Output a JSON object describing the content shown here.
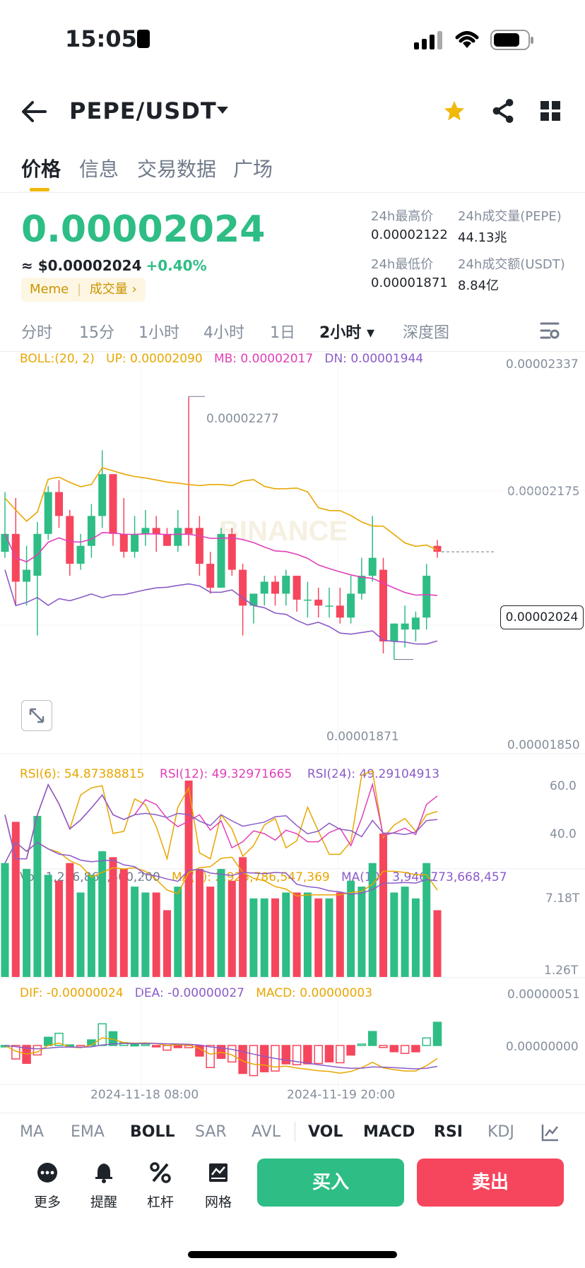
{
  "status_bar": {
    "time": "15:05"
  },
  "header": {
    "pair": "PEPE/USDT"
  },
  "tabs": [
    "价格",
    "信息",
    "交易数据",
    "广场"
  ],
  "price": {
    "last": "0.00002024",
    "usd": "≈ $0.00002024",
    "change": "+0.40%",
    "tag_meme": "Meme",
    "tag_volume": "成交量 ›"
  },
  "stats": {
    "high_label": "24h最高价",
    "high_value": "0.00002122",
    "vol_base_label": "24h成交量(PEPE)",
    "vol_base_value": "44.13兆",
    "low_label": "24h最低价",
    "low_value": "0.00001871",
    "vol_quote_label": "24h成交额(USDT)",
    "vol_quote_value": "8.84亿"
  },
  "intervals": [
    "分时",
    "15分",
    "1小时",
    "4小时",
    "1日",
    "2小时 ▾",
    "深度图"
  ],
  "boll": {
    "label": "BOLL:(20, 2)",
    "up": "UP: 0.00002090",
    "mb": "MB: 0.00002017",
    "dn": "DN: 0.00001944"
  },
  "price_axis": [
    "0.00002337",
    "0.00002175",
    "0.00001850"
  ],
  "price_marks": {
    "high": "0.00002277",
    "low": "0.00001871",
    "current": "0.00002024"
  },
  "watermark": "BINANCE",
  "rsi": {
    "r6": "RSI(6): 54.87388815",
    "r12": "RSI(12): 49.32971665",
    "r24": "RSI(24): 49.29104913",
    "axis_hi": "60.0",
    "axis_lo": "40.0"
  },
  "vol": {
    "vol": "Vol: 1,256,867,400,200",
    "ma5": "MA(5): 2,925,786,547,369",
    "ma10": "MA(10): 3,946,773,668,457",
    "axis_hi": "7.18T",
    "axis_lo": "1.26T"
  },
  "macd": {
    "dif": "DIF: -0.00000024",
    "dea": "DEA: -0.00000027",
    "macd": "MACD: 0.00000003",
    "axis_hi": "0.00000051",
    "axis_mid": "0.00000000"
  },
  "time_axis": [
    "2024-11-18 08:00",
    "2024-11-19 20:00"
  ],
  "indicator_tabs": [
    "MA",
    "EMA",
    "BOLL",
    "SAR",
    "AVL",
    "VOL",
    "MACD",
    "RSI",
    "KDJ"
  ],
  "bottom_nav": [
    "更多",
    "提醒",
    "杠杆",
    "网格"
  ],
  "buy_label": "买入",
  "sell_label": "卖出",
  "colors": {
    "green": "#2ebd85",
    "red": "#f6465d",
    "yellow": "#f0b90b",
    "boll_up": "#e8a600",
    "boll_mb": "#e040b8",
    "boll_dn": "#8a5cc7"
  },
  "chart_data": {
    "type": "candlestick",
    "candles": [
      {
        "o": 2.02e-05,
        "c": 2.05e-05,
        "h": 2.12e-05,
        "l": 2.01e-05
      },
      {
        "o": 2.05e-05,
        "c": 1.97e-05,
        "h": 2.11e-05,
        "l": 1.93e-05
      },
      {
        "o": 1.97e-05,
        "c": 1.99e-05,
        "h": 2.03e-05,
        "l": 1.93e-05
      },
      {
        "o": 1.98e-05,
        "c": 2.05e-05,
        "h": 2.07e-05,
        "l": 1.88e-05
      },
      {
        "o": 2.05e-05,
        "c": 2.12e-05,
        "h": 2.13e-05,
        "l": 2.04e-05
      },
      {
        "o": 2.12e-05,
        "c": 2.08e-05,
        "h": 2.14e-05,
        "l": 2.06e-05
      },
      {
        "o": 2.08e-05,
        "c": 2e-05,
        "h": 2.09e-05,
        "l": 1.98e-05
      },
      {
        "o": 2e-05,
        "c": 2.03e-05,
        "h": 2.05e-05,
        "l": 1.99e-05
      },
      {
        "o": 2.03e-05,
        "c": 2.08e-05,
        "h": 2.1e-05,
        "l": 2.01e-05
      },
      {
        "o": 2.08e-05,
        "c": 2.15e-05,
        "h": 2.19e-05,
        "l": 2.06e-05
      },
      {
        "o": 2.15e-05,
        "c": 2.05e-05,
        "h": 2.15e-05,
        "l": 2.03e-05
      },
      {
        "o": 2.05e-05,
        "c": 2.02e-05,
        "h": 2.11e-05,
        "l": 2.01e-05
      },
      {
        "o": 2.02e-05,
        "c": 2.05e-05,
        "h": 2.08e-05,
        "l": 2.01e-05
      },
      {
        "o": 2.05e-05,
        "c": 2.06e-05,
        "h": 2.09e-05,
        "l": 2.03e-05
      },
      {
        "o": 2.06e-05,
        "c": 2.05e-05,
        "h": 2.08e-05,
        "l": 2.02e-05
      },
      {
        "o": 2.05e-05,
        "c": 2.03e-05,
        "h": 2.06e-05,
        "l": 2.03e-05
      },
      {
        "o": 2.03e-05,
        "c": 2.06e-05,
        "h": 2.09e-05,
        "l": 2.02e-05
      },
      {
        "o": 2.06e-05,
        "c": 2.05e-05,
        "h": 2.28e-05,
        "l": 2.03e-05
      },
      {
        "o": 2.06e-05,
        "c": 2e-05,
        "h": 2.08e-05,
        "l": 1.98e-05
      },
      {
        "o": 2e-05,
        "c": 1.96e-05,
        "h": 2.02e-05,
        "l": 1.95e-05
      },
      {
        "o": 1.96e-05,
        "c": 2.05e-05,
        "h": 2.06e-05,
        "l": 1.96e-05
      },
      {
        "o": 2.05e-05,
        "c": 1.99e-05,
        "h": 2.06e-05,
        "l": 1.98e-05
      },
      {
        "o": 1.99e-05,
        "c": 1.93e-05,
        "h": 2e-05,
        "l": 1.88e-05
      },
      {
        "o": 1.93e-05,
        "c": 1.95e-05,
        "h": 1.95e-05,
        "l": 1.9e-05
      },
      {
        "o": 1.95e-05,
        "c": 1.97e-05,
        "h": 1.98e-05,
        "l": 1.93e-05
      },
      {
        "o": 1.97e-05,
        "c": 1.95e-05,
        "h": 1.98e-05,
        "l": 1.93e-05
      },
      {
        "o": 1.95e-05,
        "c": 1.98e-05,
        "h": 1.99e-05,
        "l": 1.93e-05
      },
      {
        "o": 1.98e-05,
        "c": 1.94e-05,
        "h": 1.98e-05,
        "l": 1.92e-05
      },
      {
        "o": 1.94e-05,
        "c": 1.94e-05,
        "h": 1.97e-05,
        "l": 1.91e-05
      },
      {
        "o": 1.94e-05,
        "c": 1.93e-05,
        "h": 1.96e-05,
        "l": 1.91e-05
      },
      {
        "o": 1.93e-05,
        "c": 1.93e-05,
        "h": 1.96e-05,
        "l": 1.91e-05
      },
      {
        "o": 1.93e-05,
        "c": 1.91e-05,
        "h": 1.96e-05,
        "l": 1.9e-05
      },
      {
        "o": 1.91e-05,
        "c": 1.95e-05,
        "h": 1.98e-05,
        "l": 1.9e-05
      },
      {
        "o": 1.95e-05,
        "c": 1.98e-05,
        "h": 2.01e-05,
        "l": 1.94e-05
      },
      {
        "o": 1.98e-05,
        "c": 2.01e-05,
        "h": 2.08e-05,
        "l": 1.97e-05
      },
      {
        "o": 1.99e-05,
        "c": 1.87e-05,
        "h": 2.01e-05,
        "l": 1.85e-05
      },
      {
        "o": 1.87e-05,
        "c": 1.9e-05,
        "h": 1.9e-05,
        "l": 1.84e-05
      },
      {
        "o": 1.89e-05,
        "c": 1.9e-05,
        "h": 1.93e-05,
        "l": 1.86e-05
      },
      {
        "o": 1.89e-05,
        "c": 1.91e-05,
        "h": 1.92e-05,
        "l": 1.87e-05
      },
      {
        "o": 1.91e-05,
        "c": 1.98e-05,
        "h": 2e-05,
        "l": 1.89e-05
      },
      {
        "o": 2.03e-05,
        "c": 2.02e-05,
        "h": 2.04e-05,
        "l": 2.01e-05
      }
    ]
  }
}
